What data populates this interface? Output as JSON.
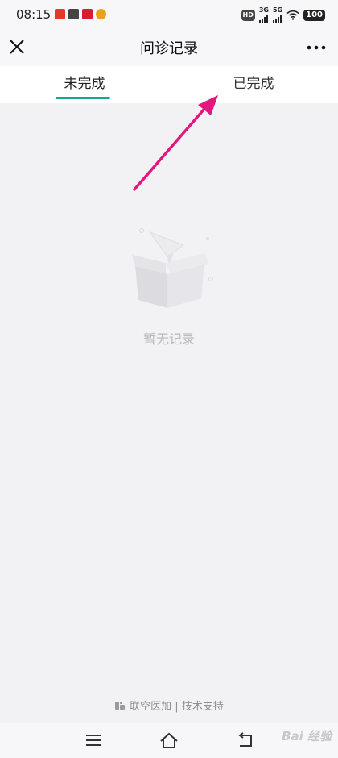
{
  "status_bar": {
    "time": "08:15",
    "signal_1": "3G",
    "signal_2": "5G",
    "hd_label": "HD",
    "battery": "100"
  },
  "nav": {
    "title": "问诊记录",
    "close_icon": "close-icon",
    "more_icon": "more-icon"
  },
  "tabs": [
    {
      "label": "未完成",
      "active": true
    },
    {
      "label": "已完成",
      "active": false
    }
  ],
  "empty_state": {
    "text": "暂无记录",
    "icon": "empty-box-icon"
  },
  "footer": {
    "text": "联空医加 | 技术支持"
  },
  "watermark": "Bai 经验",
  "colors": {
    "accent": "#1aa68a",
    "annotation_arrow": "#e3157f",
    "background": "#f2f2f4"
  }
}
